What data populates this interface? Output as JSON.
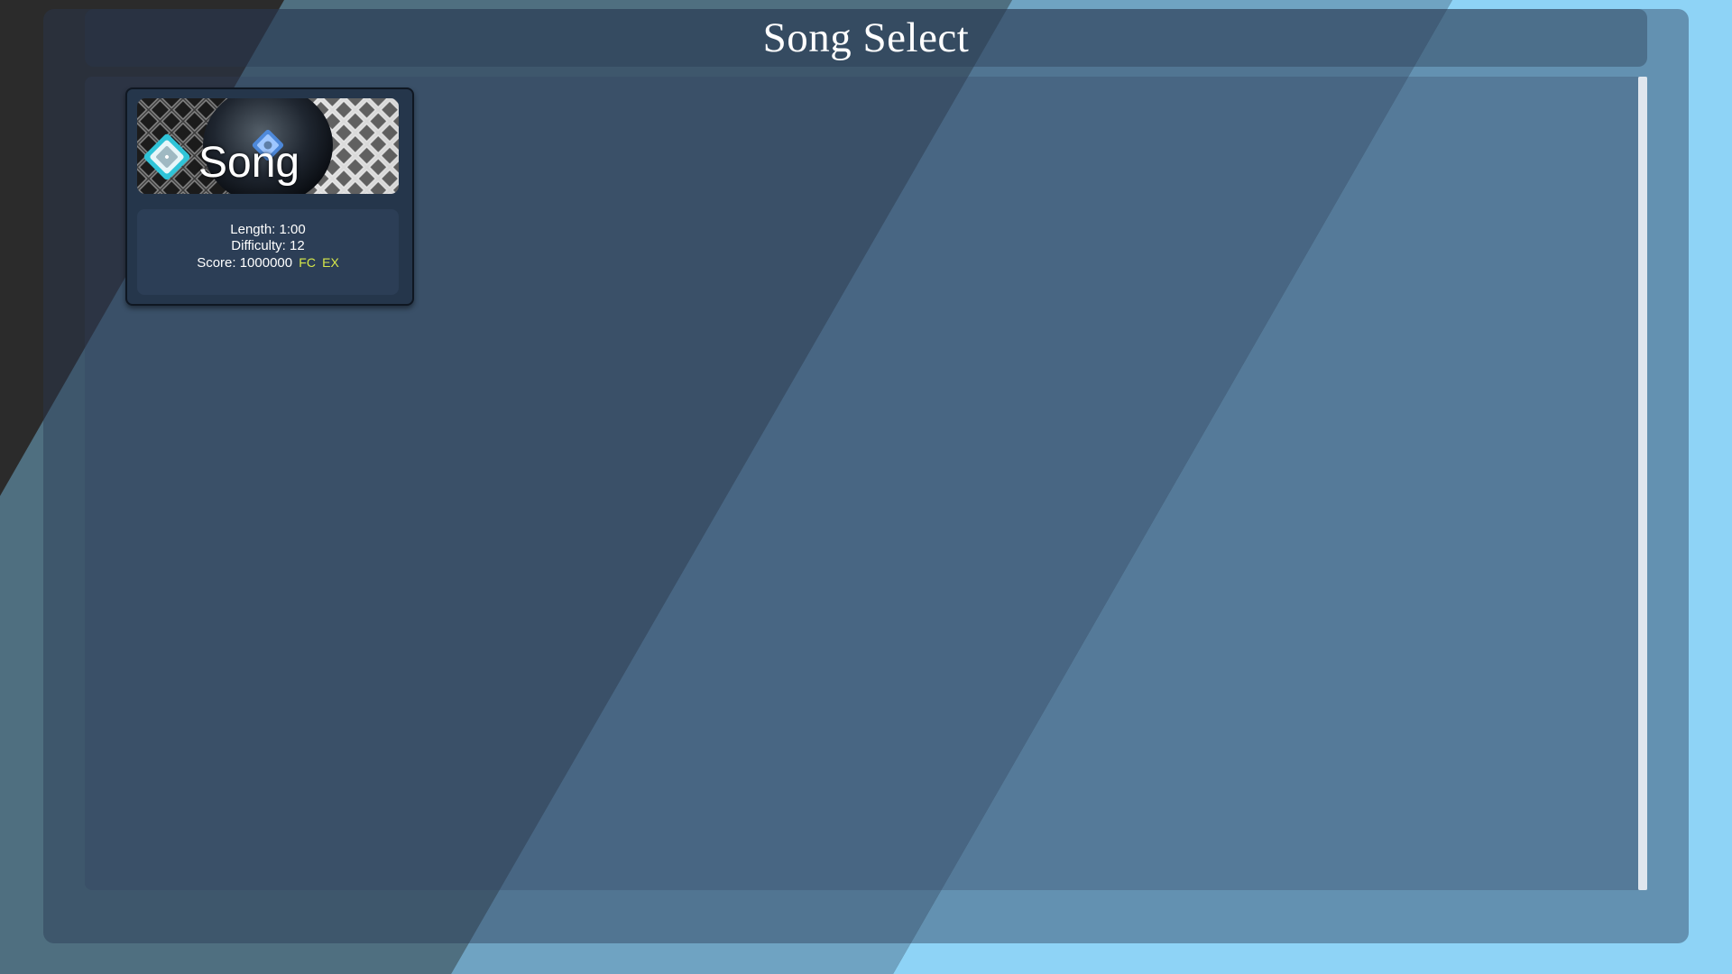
{
  "page": {
    "title": "Song Select"
  },
  "songs": [
    {
      "thumbnail_label": "Song",
      "length_text": "Length: 1:00",
      "difficulty_text": "Difficulty: 12",
      "score_text": "Score: 1000000",
      "badges": [
        "FC",
        "EX"
      ]
    }
  ],
  "colors": {
    "accent_badge": "#d7e84a",
    "card_bg": "#25364b",
    "info_bg": "#2c3e56",
    "bg_dark": "#2b2b2b",
    "bg_light_blue": "#8ed3f6"
  },
  "icons": {
    "thumbnail_left": "diamond-note-icon",
    "thumbnail_center": "diamond-note-icon"
  }
}
